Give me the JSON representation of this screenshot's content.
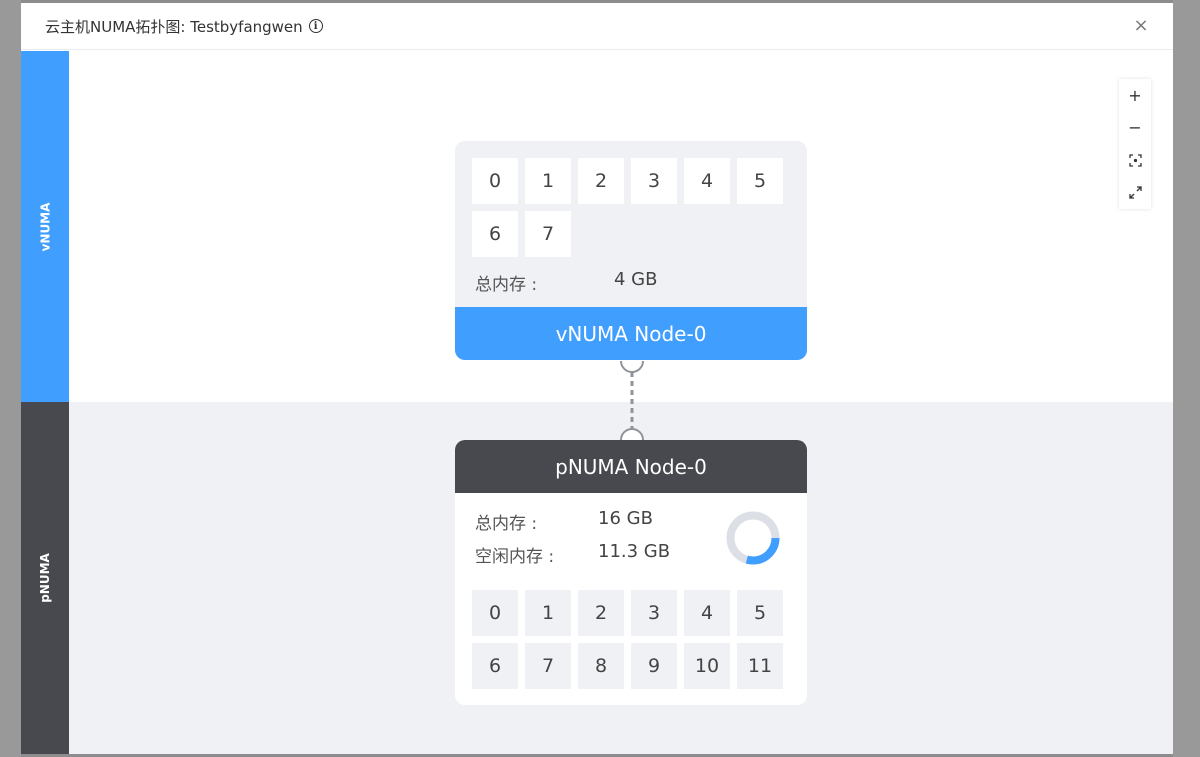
{
  "dialog": {
    "title": "云主机NUMA拓扑图: Testbyfangwen",
    "info_icon": "i",
    "close_icon": "×"
  },
  "lanes": {
    "vnuma_label": "vNUMA",
    "pnuma_label": "pNUMA"
  },
  "toolbar": {
    "zoom_in": "+",
    "zoom_out": "−",
    "icons": [
      "zoom-in-icon",
      "zoom-out-icon",
      "fit-view-icon",
      "fullscreen-icon"
    ]
  },
  "vnuma_node": {
    "title": "vNUMA Node-0",
    "cpus": [
      "0",
      "1",
      "2",
      "3",
      "4",
      "5",
      "6",
      "7"
    ],
    "mem_label": "总内存 :",
    "mem_value": "4 GB"
  },
  "pnuma_node": {
    "title": "pNUMA Node-0",
    "cpus": [
      "0",
      "1",
      "2",
      "3",
      "4",
      "5",
      "6",
      "7",
      "8",
      "9",
      "10",
      "11"
    ],
    "total_mem_label": "总内存 :",
    "total_mem_value": "16 GB",
    "free_mem_label": "空闲内存 :",
    "free_mem_value": "11.3 GB",
    "used_fraction": 0.294
  },
  "colors": {
    "accent": "#409eff",
    "dark": "#48494e",
    "lane_bg": "#f0f1f5",
    "ring_track": "#dcdfe6"
  }
}
